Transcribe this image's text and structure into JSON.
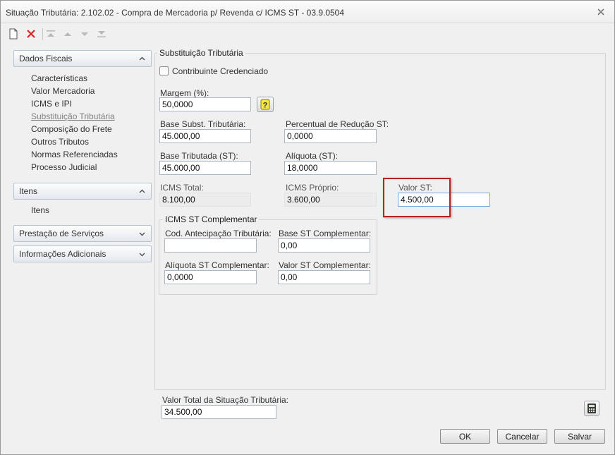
{
  "window": {
    "title": "Situação Tributária: 2.102.02 - Compra de Mercadoria p/ Revenda c/ ICMS ST - 03.9.0504"
  },
  "sidebar": {
    "sections": [
      {
        "label": "Dados Fiscais",
        "expanded": true,
        "items": [
          {
            "label": "Características"
          },
          {
            "label": "Valor Mercadoria"
          },
          {
            "label": "ICMS e IPI"
          },
          {
            "label": "Substituição Tributária",
            "active": true
          },
          {
            "label": "Composição do Frete"
          },
          {
            "label": "Outros Tributos"
          },
          {
            "label": "Normas Referenciadas"
          },
          {
            "label": "Processo Judicial"
          }
        ]
      },
      {
        "label": "Itens",
        "expanded": true,
        "items": [
          {
            "label": "Itens"
          }
        ]
      },
      {
        "label": "Prestação de Serviços",
        "expanded": false
      },
      {
        "label": "Informações Adicionais",
        "expanded": false
      }
    ]
  },
  "st": {
    "group_title": "Substituição Tributária",
    "contribuinte_label": "Contribuinte Credenciado",
    "contribuinte_checked": false,
    "margem_label": "Margem (%):",
    "margem_value": "50,0000",
    "base_subst_label": "Base Subst. Tributária:",
    "base_subst_value": "45.000,00",
    "perc_reducao_label": "Percentual de Redução ST:",
    "perc_reducao_value": "0,0000",
    "base_tributada_label": "Base Tributada (ST):",
    "base_tributada_value": "45.000,00",
    "aliquota_label": "Alíquota (ST):",
    "aliquota_value": "18,0000",
    "icms_total_label": "ICMS Total:",
    "icms_total_value": "8.100,00",
    "icms_proprio_label": "ICMS Próprio:",
    "icms_proprio_value": "3.600,00",
    "valor_st_label": "Valor ST:",
    "valor_st_value": "4.500,00"
  },
  "complementar": {
    "group_title": "ICMS ST Complementar",
    "cod_antecipacao_label": "Cod. Antecipação Tributária:",
    "cod_antecipacao_value": "",
    "base_st_label": "Base ST Complementar:",
    "base_st_value": "0,00",
    "aliquota_st_label": "Alíquota ST Complementar:",
    "aliquota_st_value": "0,0000",
    "valor_st_label": "Valor ST Complementar:",
    "valor_st_value": "0,00"
  },
  "footer": {
    "total_label": "Valor Total da Situação Tributária:",
    "total_value": "34.500,00",
    "ok_label": "OK",
    "cancel_label": "Cancelar",
    "save_label": "Salvar"
  },
  "colors": {
    "highlight": "#b32224",
    "delete_icon": "#e02020"
  }
}
